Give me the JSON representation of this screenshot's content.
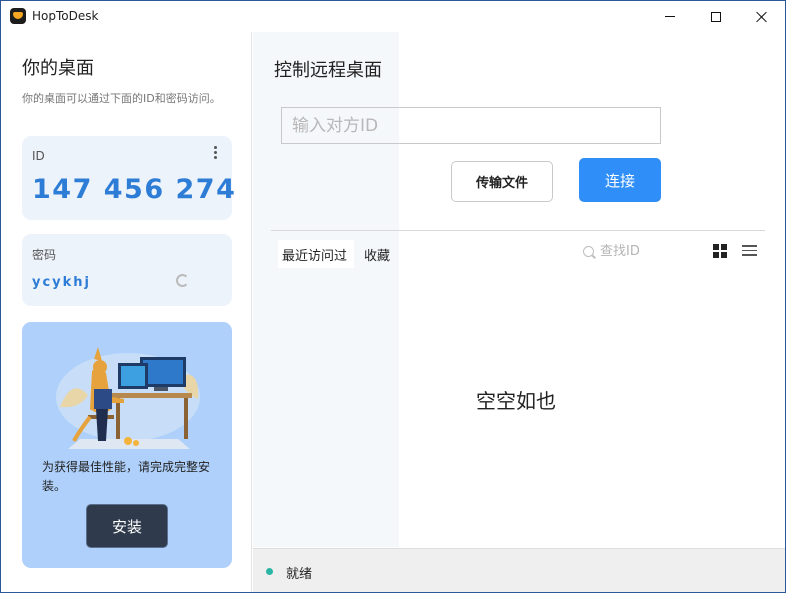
{
  "window": {
    "title": "HopToDesk"
  },
  "left": {
    "title": "你的桌面",
    "description": "你的桌面可以通过下面的ID和密码访问。",
    "id_label": "ID",
    "id_value": "147 456 274",
    "password_label": "密码",
    "password_value": "ycykhj",
    "promo_text": "为获得最佳性能，请完成完整安装。",
    "install_label": "安装"
  },
  "right": {
    "title": "控制远程桌面",
    "id_placeholder": "输入对方ID",
    "transfer_label": "传输文件",
    "connect_label": "连接",
    "tabs": [
      "最近访问过",
      "收藏"
    ],
    "search_placeholder": "查找ID",
    "empty_text": "空空如也"
  },
  "status": {
    "text": "就绪",
    "color": "#2bb5a4"
  },
  "colors": {
    "accent": "#2f8ef7",
    "id_text": "#2d7cd6",
    "promo_bg": "#aed0fb",
    "install_button": "#2f3b4c"
  }
}
